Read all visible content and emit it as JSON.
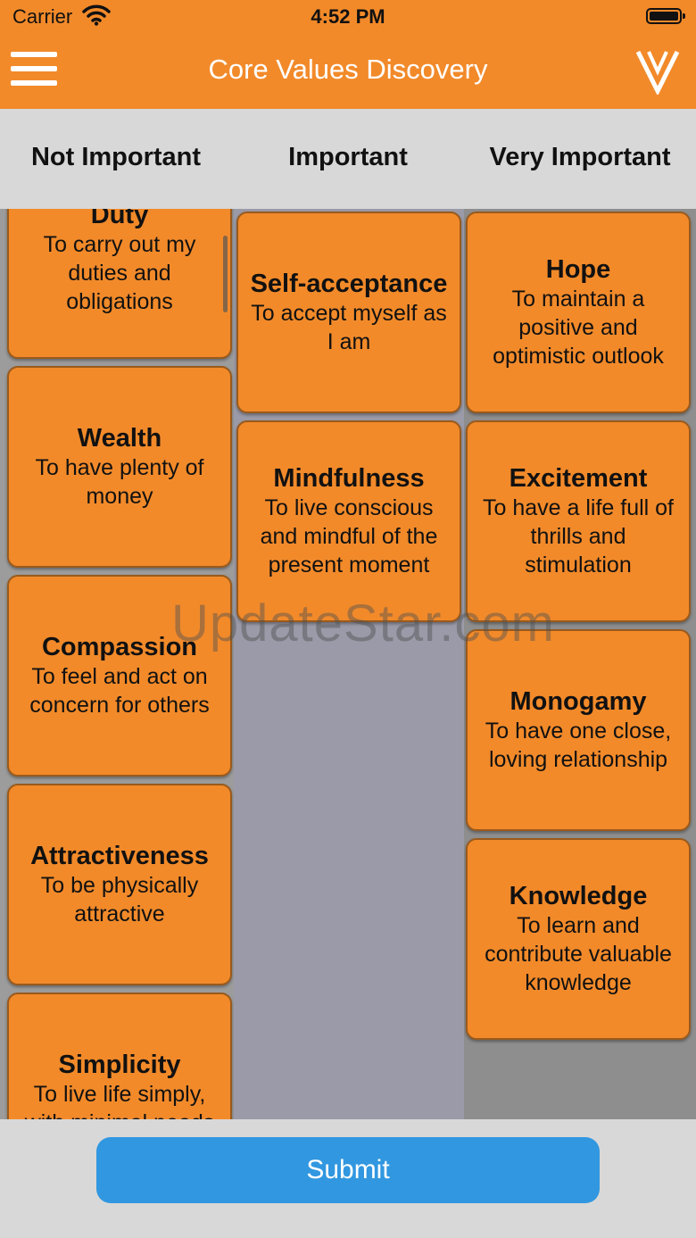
{
  "status_bar": {
    "carrier": "Carrier",
    "time": "4:52 PM",
    "wifi_icon": "wifi-icon",
    "battery_icon": "battery-icon"
  },
  "nav": {
    "title": "Core Values Discovery",
    "menu_icon": "hamburger-menu-icon",
    "logo_icon": "v-logo-icon",
    "bar_color": "#f28a2a"
  },
  "columns": {
    "not_important": "Not Important",
    "important": "Important",
    "very_important": "Very Important"
  },
  "cards": {
    "not_important": [
      {
        "title": "Duty",
        "desc": "To carry out my duties and obligations"
      },
      {
        "title": "Wealth",
        "desc": "To have plenty of money"
      },
      {
        "title": "Compassion",
        "desc": "To feel and act on concern for others"
      },
      {
        "title": "Attractiveness",
        "desc": "To be physically attractive"
      },
      {
        "title": "Simplicity",
        "desc": "To live life simply, with minimal needs"
      }
    ],
    "important": [
      {
        "title": "Self-acceptance",
        "desc": "To accept myself as I am"
      },
      {
        "title": "Mindfulness",
        "desc": "To live conscious and mindful of the present moment"
      }
    ],
    "very_important": [
      {
        "title": "Hope",
        "desc": "To maintain a positive and optimistic outlook"
      },
      {
        "title": "Excitement",
        "desc": "To have a life full of thrills and stimulation"
      },
      {
        "title": "Monogamy",
        "desc": "To have one close, loving relationship"
      },
      {
        "title": "Knowledge",
        "desc": "To learn and contribute valuable knowledge"
      }
    ],
    "card_color": "#f28a2a"
  },
  "watermark": "UpdateStar.com",
  "footer": {
    "submit_label": "Submit",
    "button_color": "#3197e0"
  }
}
